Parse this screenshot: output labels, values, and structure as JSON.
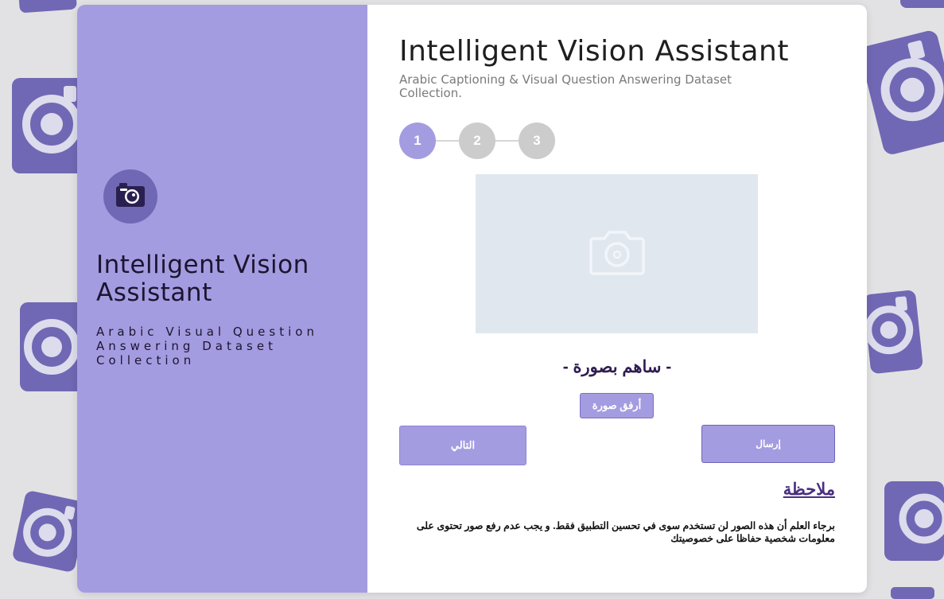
{
  "colors": {
    "accent": "#a49ce0",
    "accent_dark": "#7068b4",
    "pattern_camera": "#7068b4",
    "page_background": "#e2e2e4"
  },
  "sidebar": {
    "logo_icon": "camera-icon",
    "title": "Intelligent Vision Assistant",
    "subtitle": "Arabic Visual Question Answering Dataset Collection"
  },
  "main": {
    "title": "Intelligent Vision Assistant",
    "subtitle": "Arabic Captioning & Visual Question Answering Dataset Collection.",
    "steps": [
      {
        "label": "1",
        "active": true
      },
      {
        "label": "2",
        "active": false
      },
      {
        "label": "3",
        "active": false
      }
    ],
    "upload_placeholder_icon": "camera-icon",
    "contribute_heading": "- ساهم بصورة -",
    "attach_button": "أرفق صورة",
    "next_button": "التالي",
    "send_button": "إرسال",
    "note_title": "ملاحظة",
    "note_text": "برجاء العلم أن هذه الصور لن تستخدم سوى في تحسين التطبيق فقط. و يجب عدم رفع صور تحتوى على معلومات شخصية حفاظا على خصوصيتك"
  }
}
